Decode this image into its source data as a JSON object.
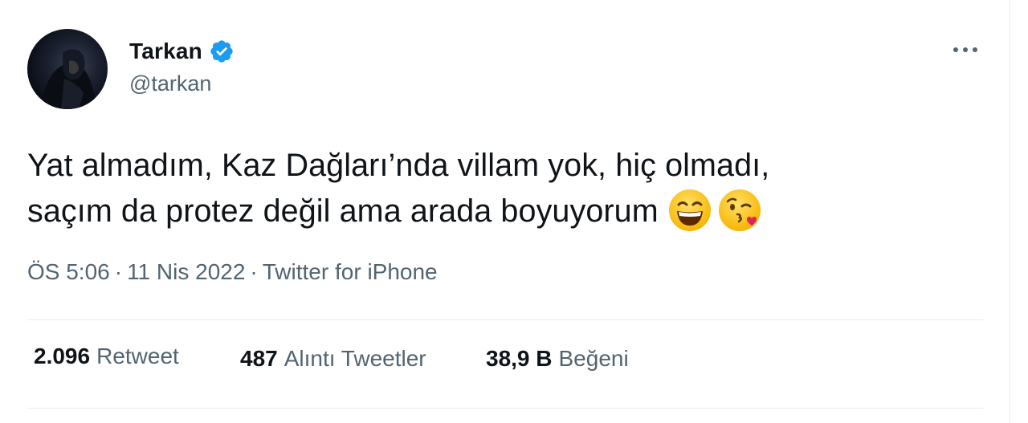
{
  "author": {
    "display_name": "Tarkan",
    "handle": "@tarkan",
    "verified": true,
    "avatar_icon": "profile-photo"
  },
  "menu": {
    "more_icon": "more-horizontal-icon"
  },
  "tweet": {
    "text_lines": [
      "Yat almadım, Kaz Dağları’nda villam yok, hiç olmadı,",
      "saçım da protez değil ama arada boyuyorum"
    ],
    "emojis": [
      "grinning-squinting-face-emoji",
      "face-blowing-a-kiss-emoji"
    ]
  },
  "meta": {
    "time": "ÖS 5:06",
    "separator": "·",
    "date": "11 Nis 2022",
    "source": "Twitter for iPhone"
  },
  "stats": {
    "retweets": {
      "count": "2.096",
      "label": "Retweet"
    },
    "quotes": {
      "count": "487",
      "label": "Alıntı Tweetler"
    },
    "likes": {
      "count": "38,9 B",
      "label": "Beğeni"
    }
  },
  "colors": {
    "text": "#0f1419",
    "secondary": "#536471",
    "verified": "#1d9bf0",
    "divider": "#e7ebee"
  }
}
